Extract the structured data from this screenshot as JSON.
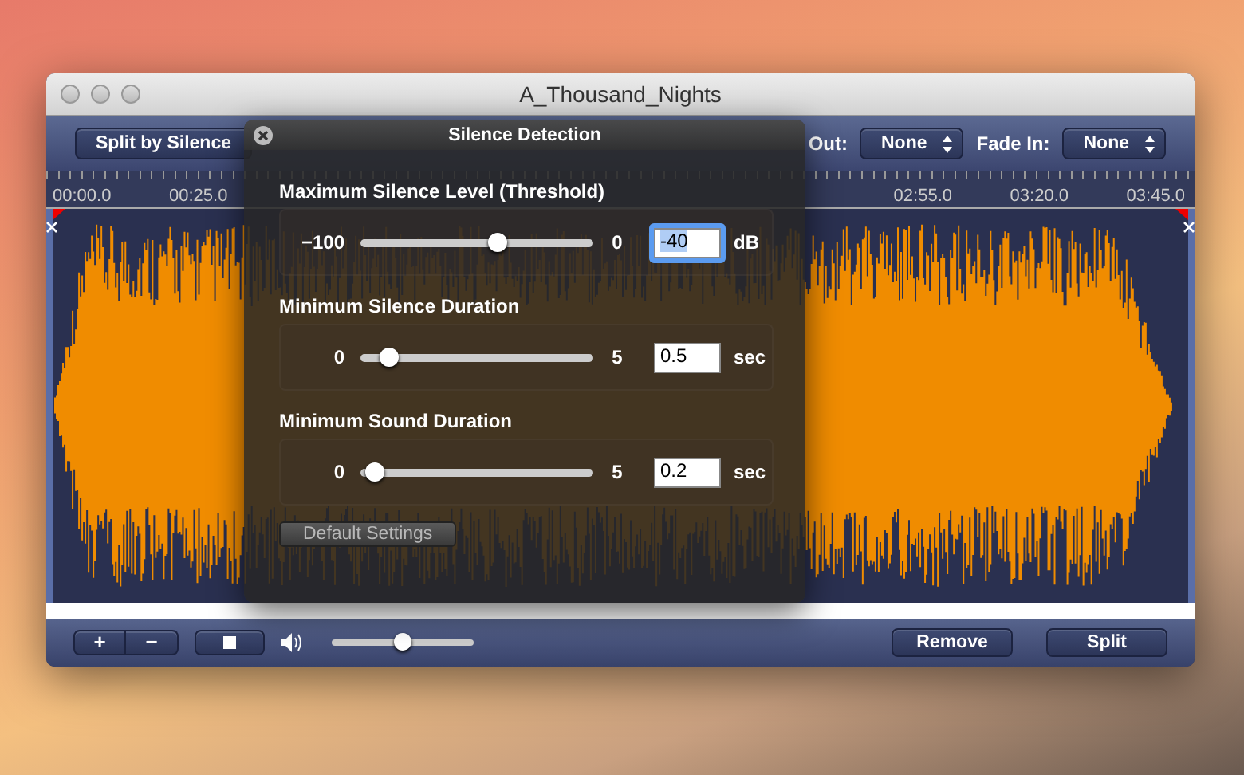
{
  "window": {
    "title": "A_Thousand_Nights"
  },
  "toolbar": {
    "split_button": "Split by Silence",
    "fade_out": {
      "label": "Out:",
      "value": "None"
    },
    "fade_in": {
      "label": "Fade In:",
      "value": "None"
    }
  },
  "ruler": {
    "left_labels": [
      "00:00.0",
      "00:25.0"
    ],
    "right_labels": [
      "02:55.0",
      "03:20.0",
      "03:45.0"
    ]
  },
  "dialog": {
    "title": "Silence Detection",
    "sections": [
      {
        "title": "Maximum Silence Level (Threshold)",
        "min": "−100",
        "max": "0",
        "value": "-40",
        "unit": "dB",
        "level": 0.59,
        "focused": true
      },
      {
        "title": "Minimum Silence Duration",
        "min": "0",
        "max": "5",
        "value": "0.5",
        "unit": "sec",
        "level": 0.12,
        "focused": false
      },
      {
        "title": "Minimum Sound Duration",
        "min": "0",
        "max": "5",
        "value": "0.2",
        "unit": "sec",
        "level": 0.06,
        "focused": false
      }
    ],
    "default_button": {
      "label": "Default Settings",
      "disabled": true
    }
  },
  "bottom_bar": {
    "add": "+",
    "remove_track": "−",
    "volume": {
      "level": 0.5
    },
    "remove_button": "Remove",
    "split_button": "Split"
  }
}
